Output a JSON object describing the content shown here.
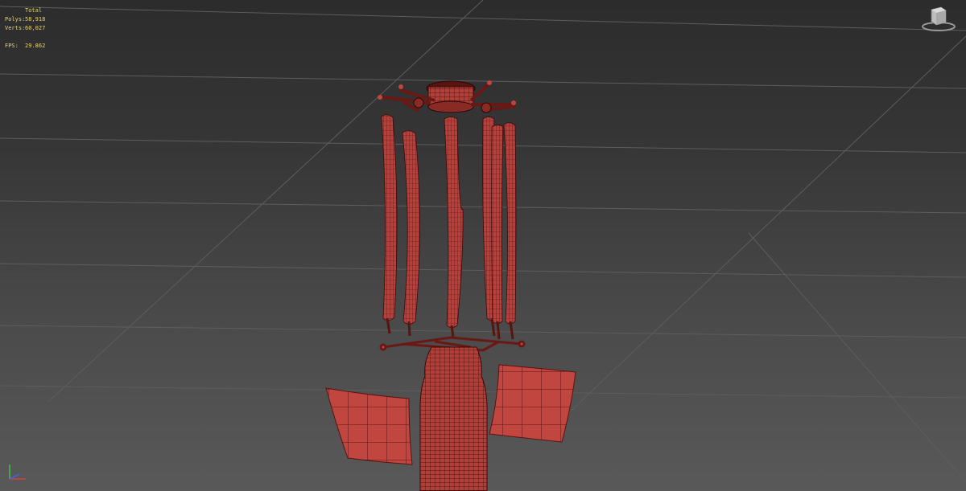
{
  "stats": {
    "header": "Total",
    "polys_label": "Polys:",
    "polys_value": "58,918",
    "verts_label": "Verts:",
    "verts_value": "60,027",
    "fps_label": "FPS:",
    "fps_value": "29.862"
  },
  "colors": {
    "mesh_fill": "#b8403a",
    "mesh_wire": "#3a0a0a",
    "grid_line": "#5d5d5d",
    "stats_text": "#e8d46a",
    "axis_x": "#d04040",
    "axis_y": "#40c040",
    "axis_z": "#4060ff"
  },
  "icons": {
    "viewcube": "viewcube-icon",
    "axis_tripod": "axis-tripod-icon"
  }
}
